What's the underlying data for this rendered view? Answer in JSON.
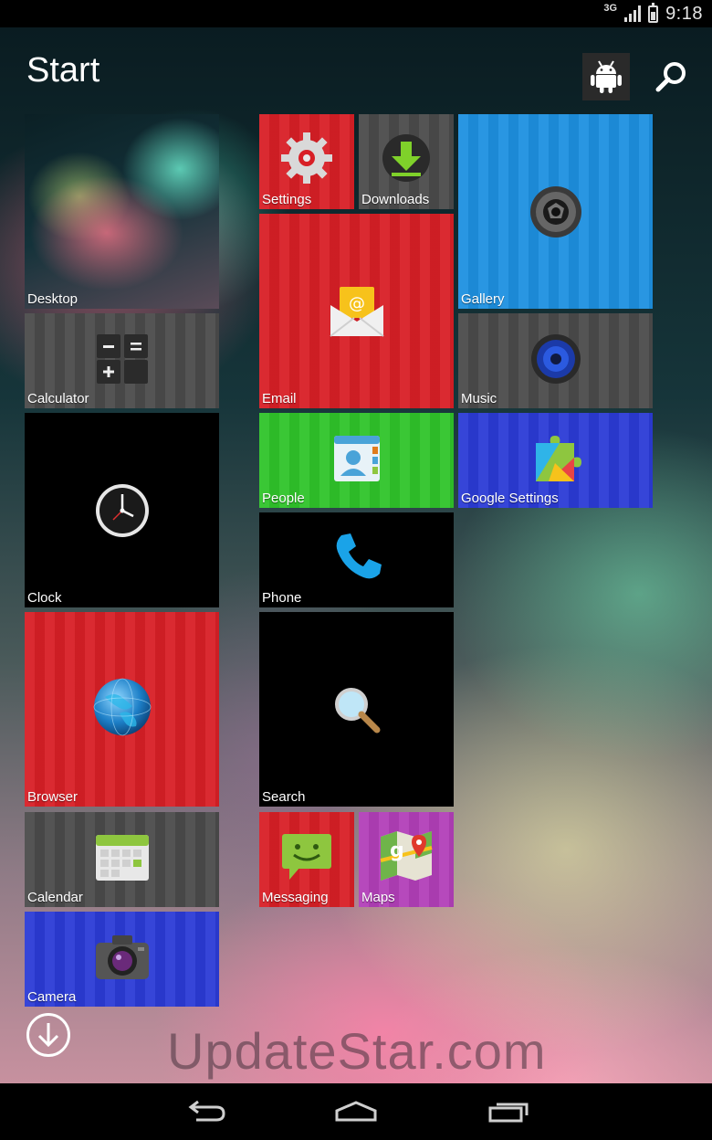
{
  "status_bar": {
    "network": "3G",
    "time": "9:18"
  },
  "header": {
    "title": "Start"
  },
  "tiles": {
    "desktop": "Desktop",
    "calculator": "Calculator",
    "clock": "Clock",
    "browser": "Browser",
    "calendar": "Calendar",
    "camera": "Camera",
    "settings": "Settings",
    "downloads": "Downloads",
    "email": "Email",
    "people": "People",
    "phone": "Phone",
    "search": "Search",
    "messaging": "Messaging",
    "maps": "Maps",
    "gallery": "Gallery",
    "music": "Music",
    "google_settings": "Google Settings"
  },
  "watermark": "UpdateStar.com",
  "icons": {
    "header": [
      "android-icon",
      "search-icon"
    ],
    "navigation": [
      "back-icon",
      "home-icon",
      "recent-apps-icon"
    ],
    "other": [
      "arrow-down-icon"
    ]
  },
  "colors": {
    "red_tile": "#d81f26",
    "gray_tile": "#4a4a4a",
    "blue_tile": "#1e90e0",
    "green_tile": "#2fc42a",
    "indigo_tile": "#2b3bd6",
    "purple_tile": "#b23fb8",
    "black_tile": "#000000"
  }
}
